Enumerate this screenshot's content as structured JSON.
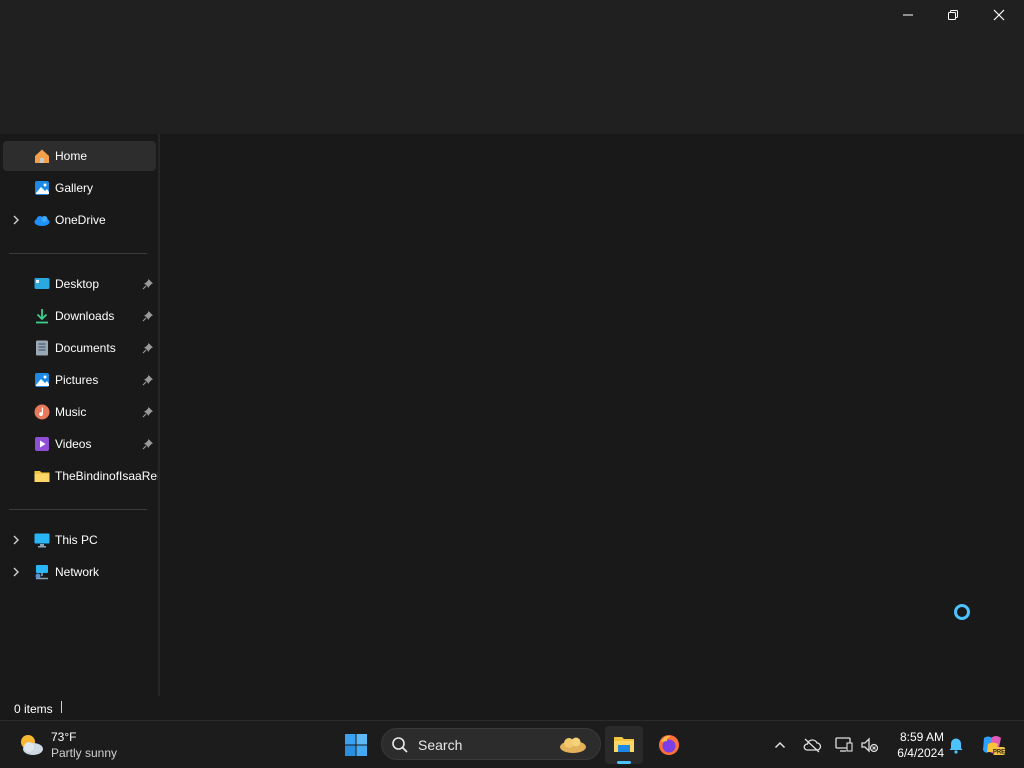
{
  "window": {
    "controls": [
      "minimize",
      "restore",
      "close"
    ]
  },
  "nav": {
    "quick": [
      {
        "label": "Home",
        "icon": "home-icon",
        "selected": true
      },
      {
        "label": "Gallery",
        "icon": "gallery-icon"
      },
      {
        "label": "OneDrive",
        "icon": "onedrive-icon",
        "expandable": true
      }
    ],
    "pinned": [
      {
        "label": "Desktop",
        "icon": "desktop-icon",
        "pinned": true
      },
      {
        "label": "Downloads",
        "icon": "downloads-icon",
        "pinned": true
      },
      {
        "label": "Documents",
        "icon": "documents-icon",
        "pinned": true
      },
      {
        "label": "Pictures",
        "icon": "pictures-icon",
        "pinned": true
      },
      {
        "label": "Music",
        "icon": "music-icon",
        "pinned": true
      },
      {
        "label": "Videos",
        "icon": "videos-icon",
        "pinned": true
      },
      {
        "label": "TheBindinofIsaaRel",
        "icon": "folder-icon",
        "pinned": false
      }
    ],
    "devices": [
      {
        "label": "This PC",
        "icon": "this-pc-icon",
        "expandable": true
      },
      {
        "label": "Network",
        "icon": "network-icon",
        "expandable": true
      }
    ]
  },
  "status": {
    "items": "0 items"
  },
  "taskbar": {
    "weather": {
      "temp": "73°F",
      "condition": "Partly sunny"
    },
    "search_placeholder": "Search",
    "clock": {
      "time": "8:59 AM",
      "date": "6/4/2024"
    }
  },
  "colors": {
    "accent": "#4cc2ff",
    "background": "#191919",
    "selected": "#2d2d2d"
  }
}
